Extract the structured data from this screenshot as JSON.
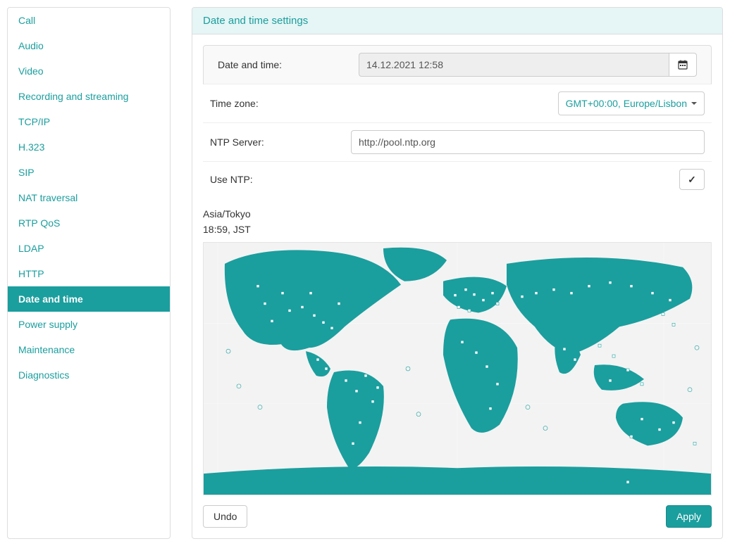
{
  "sidebar": {
    "items": [
      {
        "label": "Call",
        "active": false
      },
      {
        "label": "Audio",
        "active": false
      },
      {
        "label": "Video",
        "active": false
      },
      {
        "label": "Recording and streaming",
        "active": false
      },
      {
        "label": "TCP/IP",
        "active": false
      },
      {
        "label": "H.323",
        "active": false
      },
      {
        "label": "SIP",
        "active": false
      },
      {
        "label": "NAT traversal",
        "active": false
      },
      {
        "label": "RTP QoS",
        "active": false
      },
      {
        "label": "LDAP",
        "active": false
      },
      {
        "label": "HTTP",
        "active": false
      },
      {
        "label": "Date and time",
        "active": true
      },
      {
        "label": "Power supply",
        "active": false
      },
      {
        "label": "Maintenance",
        "active": false
      },
      {
        "label": "Diagnostics",
        "active": false
      }
    ]
  },
  "panel": {
    "title": "Date and time settings"
  },
  "form": {
    "datetime": {
      "label": "Date and time:",
      "value": "14.12.2021 12:58"
    },
    "timezone": {
      "label": "Time zone:",
      "selected": "GMT+00:00, Europe/Lisbon"
    },
    "ntp_server": {
      "label": "NTP Server:",
      "value": "http://pool.ntp.org"
    },
    "use_ntp": {
      "label": "Use NTP:",
      "checked": true
    }
  },
  "map": {
    "hover_zone": "Asia/Tokyo",
    "hover_time": "18:59, JST"
  },
  "actions": {
    "undo": "Undo",
    "apply": "Apply"
  }
}
